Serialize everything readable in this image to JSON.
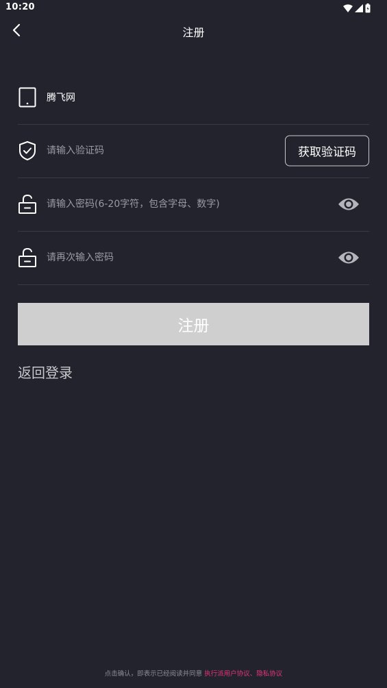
{
  "status_bar": {
    "time": "10:20"
  },
  "header": {
    "title": "注册"
  },
  "form": {
    "site_name": "腾飞网",
    "code_placeholder": "请输入验证码",
    "get_code_label": "获取验证码",
    "password_placeholder": "请输入密码(6-20字符，包含字母、数字)",
    "confirm_password_placeholder": "请再次输入密码"
  },
  "actions": {
    "register_label": "注册",
    "back_to_login_label": "返回登录"
  },
  "footer": {
    "agreement_prefix": "点击确认，即表示已经阅读并同意 ",
    "user_agreement_link": "执行派用户协议",
    "separator": "、",
    "privacy_link": "隐私协议"
  },
  "colors": {
    "background": "#23232d",
    "link": "#e5357a",
    "button_disabled": "#cfcfcf"
  },
  "icons": {
    "back": "chevron-left-icon",
    "device": "tablet-icon",
    "shield": "shield-check-icon",
    "lock": "unlock-icon",
    "eye": "eye-icon"
  }
}
